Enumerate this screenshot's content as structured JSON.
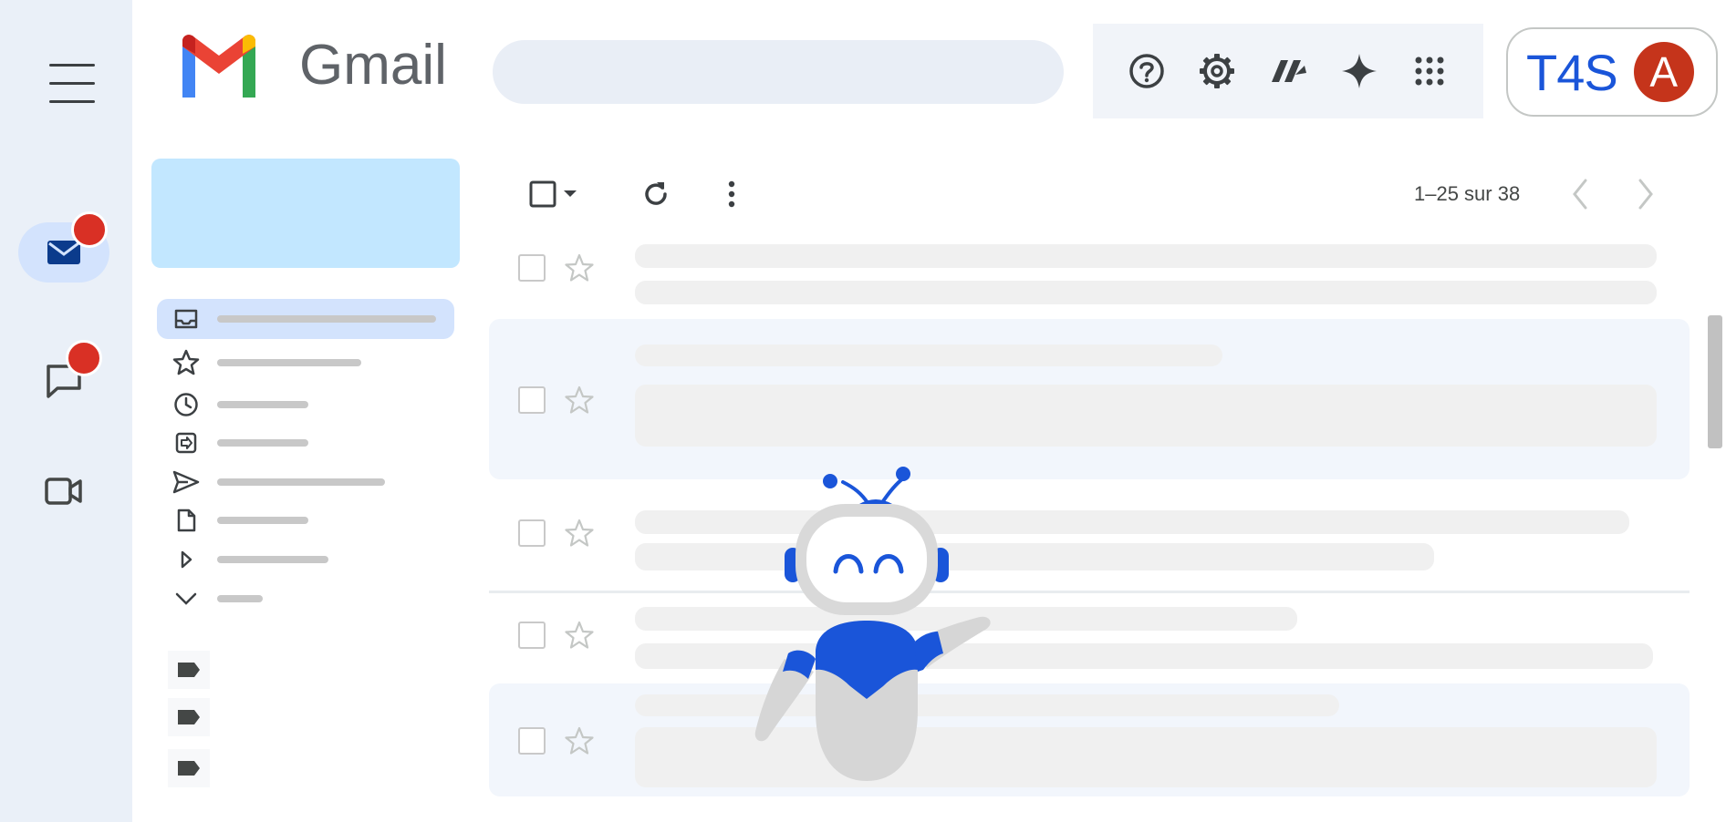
{
  "app": {
    "name": "Gmail"
  },
  "header": {
    "search_placeholder": "",
    "icons": [
      "help-icon",
      "settings-icon",
      "apps-extension-icon",
      "gemini-sparkle-icon",
      "google-apps-grid-icon"
    ],
    "org_logo": "T4S",
    "avatar_letter": "A"
  },
  "rail": {
    "items": [
      "mail",
      "chat",
      "meet"
    ],
    "notifications": {
      "mail": true,
      "chat": true
    }
  },
  "nav": {
    "items": [
      "inbox",
      "starred",
      "snoozed",
      "important",
      "sent",
      "drafts",
      "more-arrow",
      "expand-more"
    ],
    "labels_count": 3
  },
  "toolbar": {
    "pagination": "1–25 sur 38"
  },
  "mail_list": {
    "rows": [
      {
        "unread": false
      },
      {
        "unread": true
      },
      {
        "unread": false
      },
      {
        "unread": false
      },
      {
        "unread": true
      }
    ]
  },
  "colors": {
    "rail_bg": "#eaf0f8",
    "compose_bg": "#c2e7ff",
    "active_nav": "#d3e3fd",
    "notification": "#d93025",
    "avatar_bg": "#c5341b",
    "org_logo": "#1a55d9",
    "mascot_blue": "#1a55d9",
    "skeleton": "#f0f0f0"
  }
}
